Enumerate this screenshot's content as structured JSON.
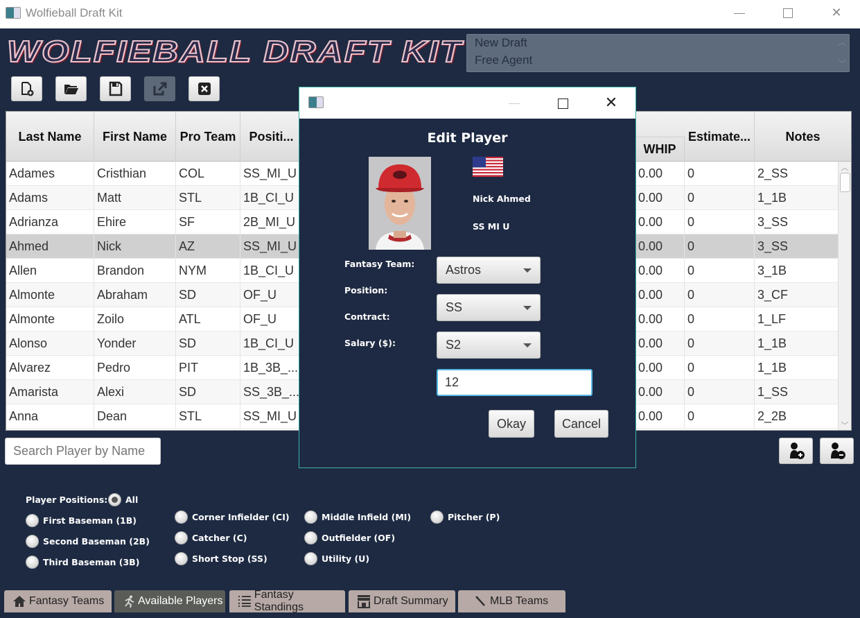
{
  "window": {
    "title": "Wolfieball Draft Kit",
    "logo_text": "WOLFIEBALL DRAFT KIT"
  },
  "draft_list": {
    "items": [
      "New Draft",
      "Free Agent"
    ]
  },
  "toolbar": {
    "buttons": [
      {
        "name": "new-draft",
        "icon": "new-file-icon"
      },
      {
        "name": "open-draft",
        "icon": "folder-open-icon"
      },
      {
        "name": "save-draft",
        "icon": "floppy-save-icon"
      },
      {
        "name": "export-draft",
        "icon": "export-icon",
        "disabled": true
      },
      {
        "name": "exit",
        "icon": "close-box-icon"
      }
    ]
  },
  "table": {
    "columns": [
      "Last Name",
      "First Name",
      "Pro Team",
      "Positi...",
      "WHIP",
      "Estimate...",
      "Notes"
    ],
    "rows": [
      {
        "last": "Adames",
        "first": "Cristhian",
        "team": "COL",
        "pos": "SS_MI_U",
        "whip": "0.00",
        "est": "0",
        "notes": "2_SS"
      },
      {
        "last": "Adams",
        "first": "Matt",
        "team": "STL",
        "pos": "1B_CI_U",
        "whip": "0.00",
        "est": "0",
        "notes": "1_1B"
      },
      {
        "last": "Adrianza",
        "first": "Ehire",
        "team": "SF",
        "pos": "2B_MI_U",
        "whip": "0.00",
        "est": "0",
        "notes": "3_SS"
      },
      {
        "last": "Ahmed",
        "first": "Nick",
        "team": "AZ",
        "pos": "SS_MI_U",
        "whip": "0.00",
        "est": "0",
        "notes": "3_SS",
        "selected": true
      },
      {
        "last": "Allen",
        "first": "Brandon",
        "team": "NYM",
        "pos": "1B_CI_U",
        "whip": "0.00",
        "est": "0",
        "notes": "3_1B"
      },
      {
        "last": "Almonte",
        "first": "Abraham",
        "team": "SD",
        "pos": "OF_U",
        "whip": "0.00",
        "est": "0",
        "notes": "3_CF"
      },
      {
        "last": "Almonte",
        "first": "Zoilo",
        "team": "ATL",
        "pos": "OF_U",
        "whip": "0.00",
        "est": "0",
        "notes": "1_LF"
      },
      {
        "last": "Alonso",
        "first": "Yonder",
        "team": "SD",
        "pos": "1B_CI_U",
        "whip": "0.00",
        "est": "0",
        "notes": "1_1B"
      },
      {
        "last": "Alvarez",
        "first": "Pedro",
        "team": "PIT",
        "pos": "1B_3B_...",
        "whip": "0.00",
        "est": "0",
        "notes": "1_1B"
      },
      {
        "last": "Amarista",
        "first": "Alexi",
        "team": "SD",
        "pos": "SS_3B_...",
        "whip": "0.00",
        "est": "0",
        "notes": "1_SS"
      },
      {
        "last": "Anna",
        "first": "Dean",
        "team": "STL",
        "pos": "SS_MI_U",
        "whip": "0.00",
        "est": "0",
        "notes": "2_2B"
      }
    ]
  },
  "search": {
    "placeholder": "Search Player by Name",
    "value": ""
  },
  "filters": {
    "label": "Player Positions:",
    "options": [
      {
        "label": "All",
        "checked": true
      },
      {
        "label": "First Baseman (1B)"
      },
      {
        "label": "Second Baseman (2B)"
      },
      {
        "label": "Third Baseman (3B)"
      },
      {
        "label": "Corner Infielder (CI)"
      },
      {
        "label": "Catcher (C)"
      },
      {
        "label": "Short Stop (SS)"
      },
      {
        "label": "Middle Infield (MI)"
      },
      {
        "label": "Outfielder (OF)"
      },
      {
        "label": "Utility (U)"
      },
      {
        "label": "Pitcher (P)"
      }
    ]
  },
  "tabs": [
    {
      "label": "Fantasy Teams",
      "icon": "home-icon"
    },
    {
      "label": "Available Players",
      "icon": "running-icon",
      "active": true
    },
    {
      "label": "Fantasy Standings",
      "icon": "list-icon"
    },
    {
      "label": "Draft Summary",
      "icon": "store-icon"
    },
    {
      "label": "MLB Teams",
      "icon": "bat-icon"
    }
  ],
  "dialog": {
    "title": "Edit Player",
    "player_name": "Nick Ahmed",
    "positions": "SS MI U",
    "labels": {
      "fantasy_team": "Fantasy Team:",
      "position": "Position:",
      "contract": "Contract:",
      "salary": "Salary ($):"
    },
    "fantasy_team_value": "Astros",
    "position_value": "SS",
    "contract_value": "S2",
    "salary_value": "12",
    "okay_label": "Okay",
    "cancel_label": "Cancel"
  }
}
